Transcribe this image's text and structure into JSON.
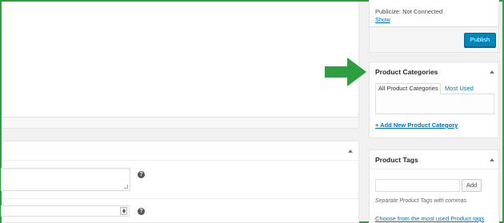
{
  "publish": {
    "publicize_text": "Publicize: Not Connected",
    "show_link": "Show",
    "publish_label": "Publish"
  },
  "categories": {
    "title": "Product Categories",
    "tab_all": "All Product Categories",
    "tab_most_used": "Most Used",
    "add_new_link": "+ Add New Product Category"
  },
  "tags": {
    "title": "Product Tags",
    "add_label": "Add",
    "hint": "Separate Product Tags with commas",
    "choose_link": "Choose from the most used Product tags"
  },
  "help": {
    "icon_glyph": "?"
  },
  "colors": {
    "annotation_arrow": "#2e9e3e",
    "primary_button": "#0085ba",
    "link": "#0073aa"
  }
}
